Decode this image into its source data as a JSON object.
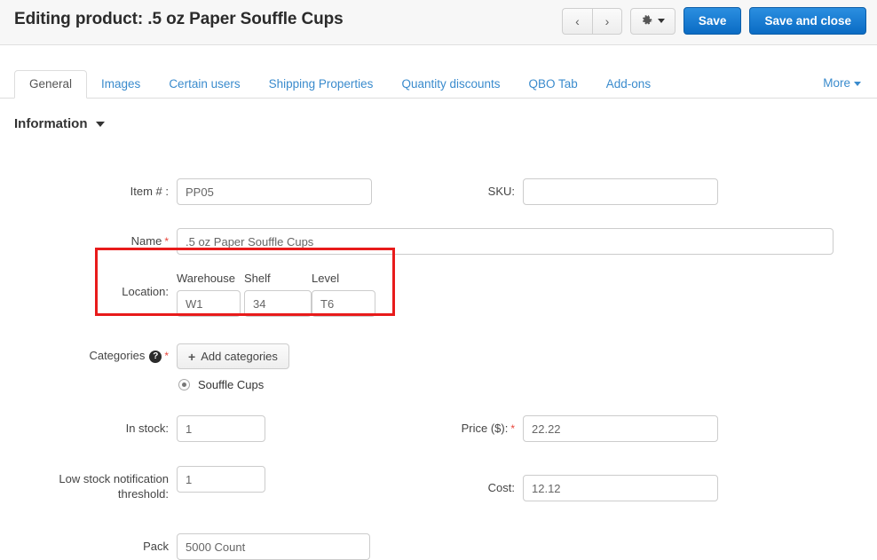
{
  "header": {
    "title": "Editing product: .5 oz Paper Souffle Cups",
    "prev_icon": "chevron-left-icon",
    "next_icon": "chevron-right-icon",
    "gear_icon": "gear-icon",
    "save_label": "Save",
    "save_close_label": "Save and close"
  },
  "tabs": [
    {
      "label": "General",
      "active": true
    },
    {
      "label": "Images",
      "active": false
    },
    {
      "label": "Certain users",
      "active": false
    },
    {
      "label": "Shipping Properties",
      "active": false
    },
    {
      "label": "Quantity discounts",
      "active": false
    },
    {
      "label": "QBO Tab",
      "active": false
    },
    {
      "label": "Add-ons",
      "active": false
    }
  ],
  "more_label": "More",
  "section": {
    "title": "Information"
  },
  "fields": {
    "item_number": {
      "label": "Item # :",
      "value": "PP05",
      "placeholder": ""
    },
    "sku": {
      "label": "SKU:",
      "value": "",
      "placeholder": ""
    },
    "name": {
      "label": "Name",
      "value": ".5 oz Paper Souffle Cups",
      "required": "*"
    },
    "location": {
      "label": "Location:",
      "columns": [
        "Warehouse",
        "Shelf",
        "Level"
      ],
      "warehouse": "W1",
      "shelf": "34",
      "level": "T6"
    },
    "categories": {
      "label": "Categories",
      "help_icon": "?",
      "required": "*",
      "add_button": "Add categories",
      "selected": "Souffle Cups"
    },
    "in_stock": {
      "label": "In stock:",
      "value": "1"
    },
    "price": {
      "label": "Price ($):",
      "value": "22.22",
      "required": "*"
    },
    "low_stock": {
      "label_line1": "Low stock notification",
      "label_line2": "threshold:",
      "value": "1"
    },
    "cost": {
      "label": "Cost:",
      "value": "12.12"
    },
    "pack": {
      "label": "Pack",
      "value": "5000 Count"
    }
  },
  "colors": {
    "accent_blue": "#0a6bc4",
    "link_blue": "#3a8bcd",
    "highlight_red": "#e81b1b",
    "required_red": "#e8443a"
  }
}
